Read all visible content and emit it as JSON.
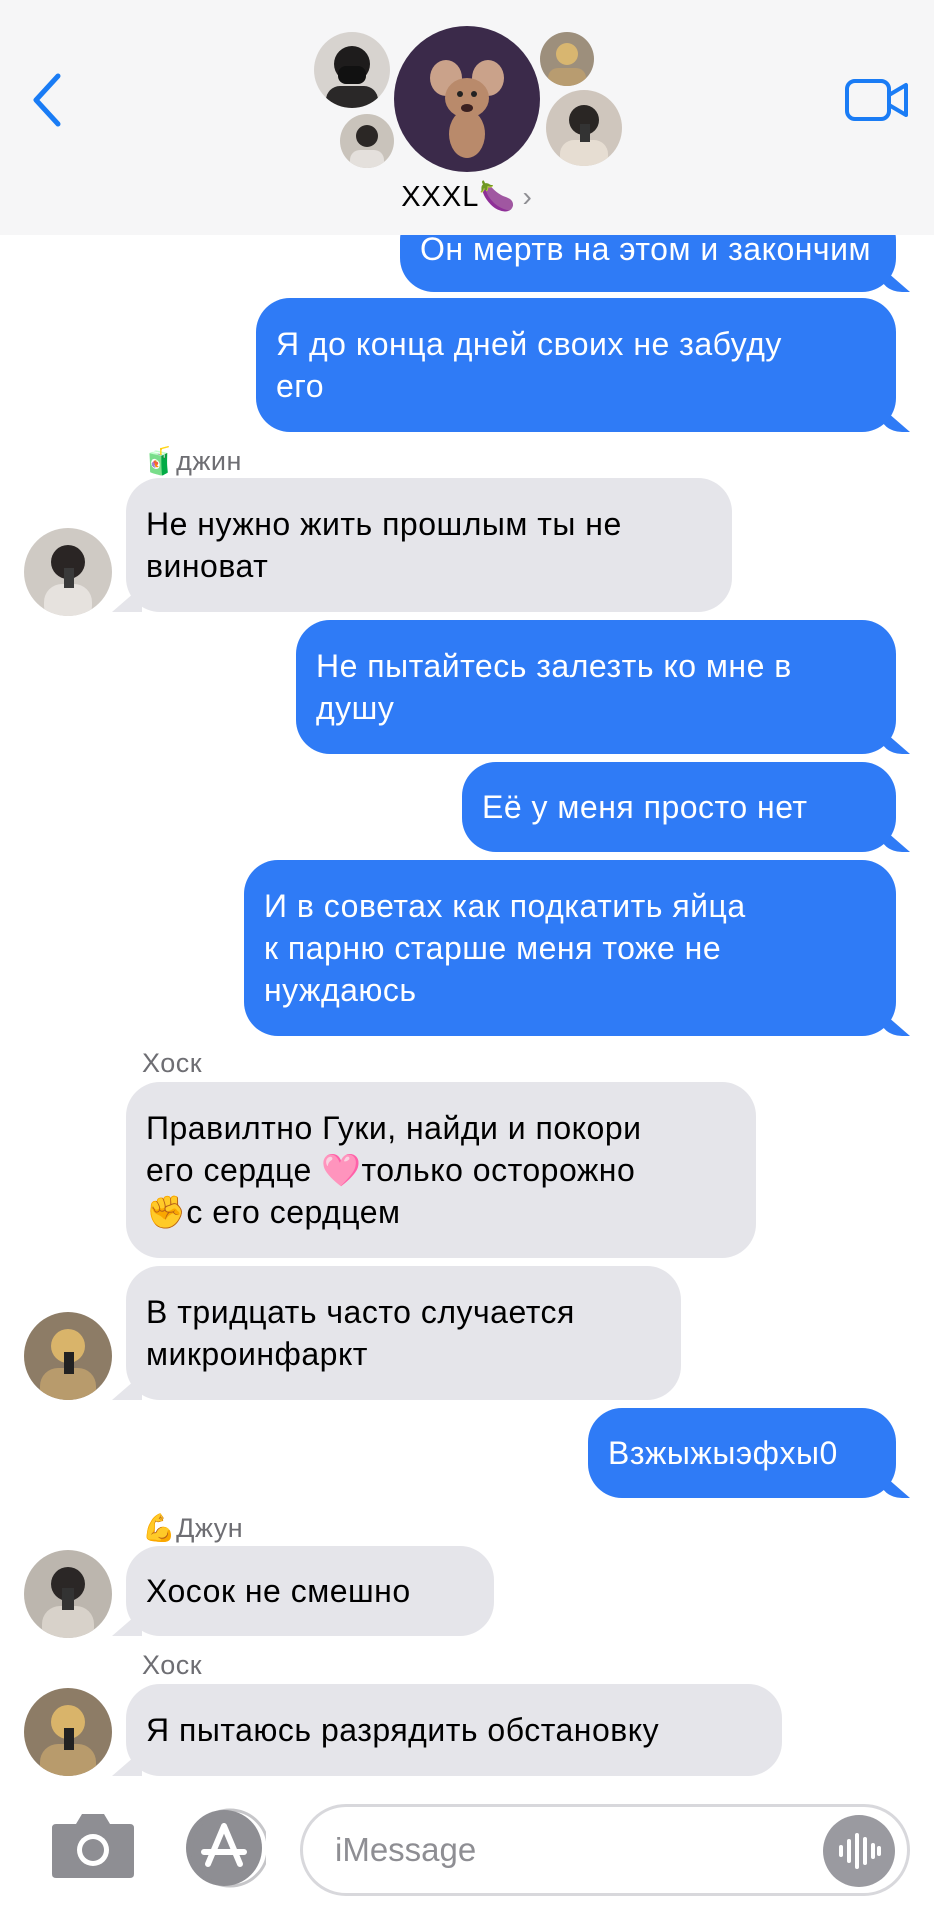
{
  "header": {
    "group_name": "XXXL🍆",
    "chevron": "›",
    "back_icon": "chevron-left-icon",
    "video_icon": "video-camera-icon",
    "accent": "#1a7cf5"
  },
  "messages": [
    {
      "side": "out",
      "text": "Он мертв   на этом и закончим"
    },
    {
      "side": "out",
      "text": "Я до конца дней своих не забуду\nего"
    },
    {
      "side": "in",
      "sender": "🧃джин",
      "text": "Не нужно жить прошлым ты не\nвиноват"
    },
    {
      "side": "out",
      "text": "Не пытайтесь залезть ко мне в\nдушу"
    },
    {
      "side": "out",
      "text": "Её у меня просто нет"
    },
    {
      "side": "out",
      "text": "И в советах  как подкатить яйца\nк парню старше меня тоже не\nнуждаюсь"
    },
    {
      "side": "in",
      "sender": "Хоск",
      "text": "Правилтно Гуки, найди и покори\nего сердце 🩷только осторожно\n✊с его сердцем"
    },
    {
      "side": "in",
      "text": "В тридцать часто  случается\nмикроинфаркт"
    },
    {
      "side": "out",
      "text": "Взжыжыэфхы0"
    },
    {
      "side": "in",
      "sender": "💪Джун",
      "text": "Хосок не смешно"
    },
    {
      "side": "in",
      "sender": "Хоск",
      "text": "Я пытаюсь разрядить обстановку"
    }
  ],
  "composer": {
    "placeholder": "iMessage",
    "camera_icon": "camera-icon",
    "apps_icon": "app-store-icon",
    "mic_icon": "voice-waveform-icon"
  },
  "colors": {
    "outgoing": "#2f7bf6",
    "incoming": "#e5e5ea",
    "header_bg": "#f6f6f7"
  }
}
